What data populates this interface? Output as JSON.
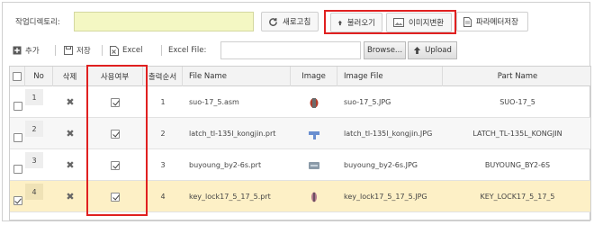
{
  "toolbar": {
    "dir_label": "작업디렉토리:",
    "dir_value": "",
    "refresh_label": "새로고침",
    "load_label": "불러오기",
    "imgconv_label": "이미지변환",
    "paramsave_label": "파라메터저장"
  },
  "subbar": {
    "add_label": "추가",
    "save_label": "저장",
    "excel_label": "Excel",
    "excel_file_label": "Excel File:",
    "file_value": "",
    "browse_label": "Browse...",
    "upload_label": "Upload"
  },
  "grid": {
    "headers": {
      "no": "No",
      "delete": "삭제",
      "use": "사용여부",
      "order": "출력순서",
      "file_name": "File Name",
      "image": "Image",
      "image_file": "Image File",
      "part_name": "Part Name"
    },
    "rows": [
      {
        "no": "1",
        "order": "1",
        "file_name": "suo-17_5.asm",
        "image_file": "suo-17_5.JPG",
        "part_name": "SUO-17_5",
        "checked": false,
        "use": true
      },
      {
        "no": "2",
        "order": "2",
        "file_name": "latch_tl-135l_kongjin.prt",
        "image_file": "latch_tl-135l_kongjin.JPG",
        "part_name": "LATCH_TL-135L_KONGJIN",
        "checked": false,
        "use": true
      },
      {
        "no": "3",
        "order": "3",
        "file_name": "buyoung_by2-6s.prt",
        "image_file": "buyoung_by2-6s.JPG",
        "part_name": "BUYOUNG_BY2-6S",
        "checked": false,
        "use": true
      },
      {
        "no": "4",
        "order": "4",
        "file_name": "key_lock17_5_17_5.prt",
        "image_file": "key_lock17_5_17_5.JPG",
        "part_name": "KEY_LOCK17_5_17_5",
        "checked": true,
        "use": true
      }
    ]
  },
  "colors": {
    "accent_red": "#e02020",
    "dir_input_bg": "#f4f7c3",
    "selected_row_bg": "#fdf0c6"
  }
}
